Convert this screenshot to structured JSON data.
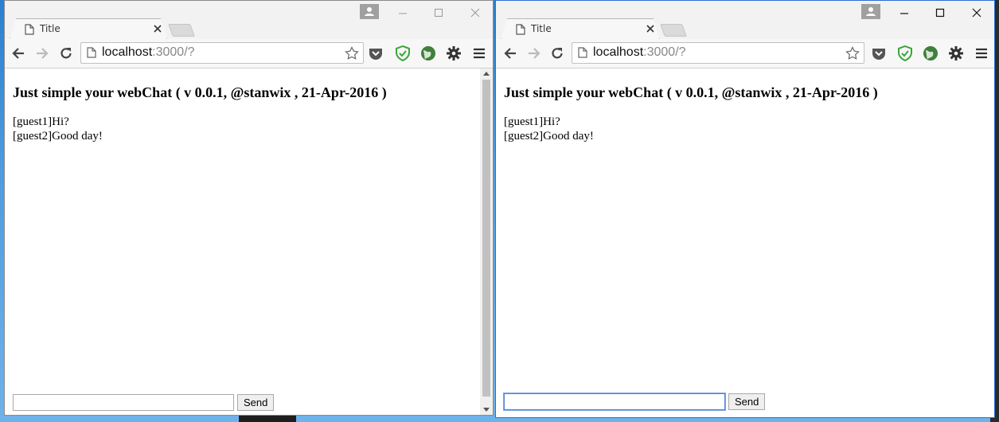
{
  "windows": [
    {
      "tab_title": "Title",
      "url_host": "localhost",
      "url_path": ":3000/?",
      "page_heading": "Just simple your webChat ( v 0.0.1, @stanwix , 21-Apr-2016 )",
      "messages": [
        "[guest1]Hi?",
        "[guest2]Good day!"
      ],
      "input_value": "",
      "send_label": "Send"
    },
    {
      "tab_title": "Title",
      "url_host": "localhost",
      "url_path": ":3000/?",
      "page_heading": "Just simple your webChat ( v 0.0.1, @stanwix , 21-Apr-2016 )",
      "messages": [
        "[guest1]Hi?",
        "[guest2]Good day!"
      ],
      "input_value": "",
      "send_label": "Send"
    }
  ],
  "icons": [
    "file-icon",
    "close-icon",
    "new-tab-icon",
    "user-icon",
    "minimize-icon",
    "maximize-icon",
    "window-close-icon",
    "back-icon",
    "forward-icon",
    "reload-icon",
    "bookmark-star-icon",
    "pocket-icon",
    "shield-check-icon",
    "globe-extension-icon",
    "gear-icon",
    "menu-icon"
  ],
  "colors": {
    "accent_border": "#2b6fd6",
    "shield_green": "#3aa53a"
  }
}
